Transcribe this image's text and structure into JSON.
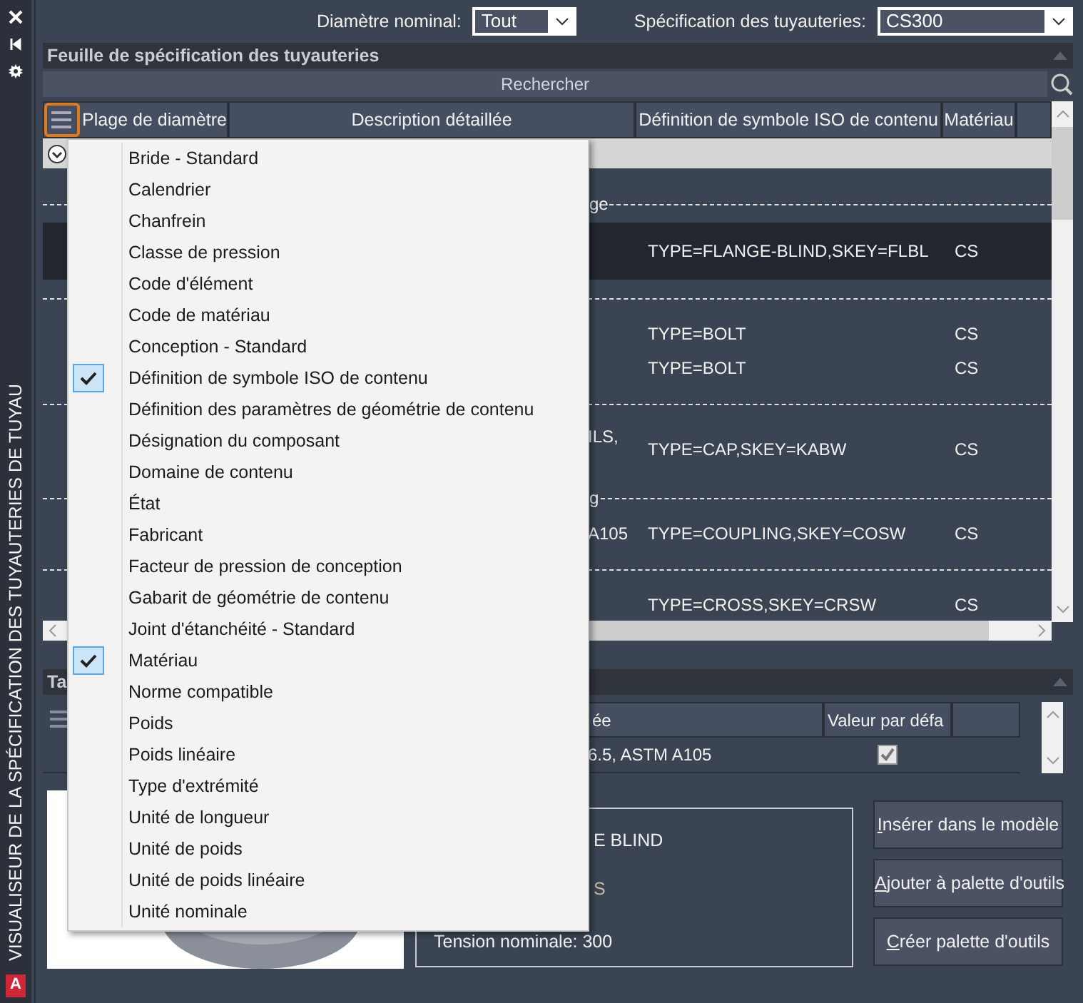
{
  "sidebar": {
    "title": "VISUALISEUR DE LA SPÉCIFICATION DES TUYAUTERIES DE TUYAU",
    "app_icon_letter": "A"
  },
  "filters": [
    {
      "label": "Diamètre nominal:",
      "value": "Tout"
    },
    {
      "label": "Spécification des tuyauteries:",
      "value": "CS300"
    }
  ],
  "spec_sheet": {
    "title": "Feuille de spécification des tuyauteries",
    "search": {
      "placeholder": "Rechercher"
    },
    "columns": [
      "Plage de diamètre",
      "Description détaillée",
      "Définition de symbole ISO de contenu",
      "Matériau"
    ],
    "rows": [
      {
        "kind": "separator",
        "label": "ge"
      },
      {
        "kind": "item",
        "selected": true,
        "iso": "TYPE=FLANGE-BLIND,SKEY=FLBL",
        "material": "CS"
      },
      {
        "kind": "separator"
      },
      {
        "kind": "item",
        "selected": false,
        "iso": "TYPE=BOLT",
        "material": "CS"
      },
      {
        "kind": "item",
        "selected": false,
        "iso": "TYPE=BOLT",
        "material": "CS"
      },
      {
        "kind": "separator"
      },
      {
        "kind": "item",
        "selected": false,
        "fragment": "ILS,",
        "iso": "TYPE=CAP,SKEY=KABW",
        "material": "CS"
      },
      {
        "kind": "separator",
        "label": "g"
      },
      {
        "kind": "item",
        "selected": false,
        "fragment": "A105",
        "iso": "TYPE=COUPLING,SKEY=COSW",
        "material": "CS"
      },
      {
        "kind": "separator"
      },
      {
        "kind": "item",
        "selected": false,
        "iso": "TYPE=CROSS,SKEY=CRSW",
        "material": "CS"
      }
    ]
  },
  "column_menu": {
    "items": [
      {
        "label": "Bride - Standard",
        "checked": false
      },
      {
        "label": "Calendrier",
        "checked": false
      },
      {
        "label": "Chanfrein",
        "checked": false
      },
      {
        "label": "Classe de pression",
        "checked": false
      },
      {
        "label": "Code d'élément",
        "checked": false
      },
      {
        "label": "Code de matériau",
        "checked": false
      },
      {
        "label": "Conception - Standard",
        "checked": false
      },
      {
        "label": "Définition de symbole ISO de contenu",
        "checked": true
      },
      {
        "label": "Définition des paramètres de géométrie de contenu",
        "checked": false
      },
      {
        "label": "Désignation du composant",
        "checked": false
      },
      {
        "label": "Domaine de contenu",
        "checked": false
      },
      {
        "label": "État",
        "checked": false
      },
      {
        "label": "Fabricant",
        "checked": false
      },
      {
        "label": "Facteur de pression de conception",
        "checked": false
      },
      {
        "label": "Gabarit de géométrie de contenu",
        "checked": false
      },
      {
        "label": "Joint d'étanchéité - Standard",
        "checked": false
      },
      {
        "label": "Matériau",
        "checked": true
      },
      {
        "label": "Norme compatible",
        "checked": false
      },
      {
        "label": "Poids",
        "checked": false
      },
      {
        "label": "Poids linéaire",
        "checked": false
      },
      {
        "label": "Type d'extrémité",
        "checked": false
      },
      {
        "label": "Unité de longueur",
        "checked": false
      },
      {
        "label": "Unité de poids",
        "checked": false
      },
      {
        "label": "Unité de poids linéaire",
        "checked": false
      },
      {
        "label": "Unité nominale",
        "checked": false
      }
    ]
  },
  "part_table": {
    "title": "Ta",
    "columns": [
      "ée",
      "Valeur par défa"
    ],
    "rows": [
      {
        "description": "6.5, ASTM A105",
        "default": true
      }
    ]
  },
  "details": {
    "lines": [
      "E BLIND",
      "S",
      "Tension nominale: 300"
    ]
  },
  "buttons": [
    "Insérer dans le modèle",
    "Ajouter à palette d'outils",
    "Créer palette d'outils"
  ]
}
